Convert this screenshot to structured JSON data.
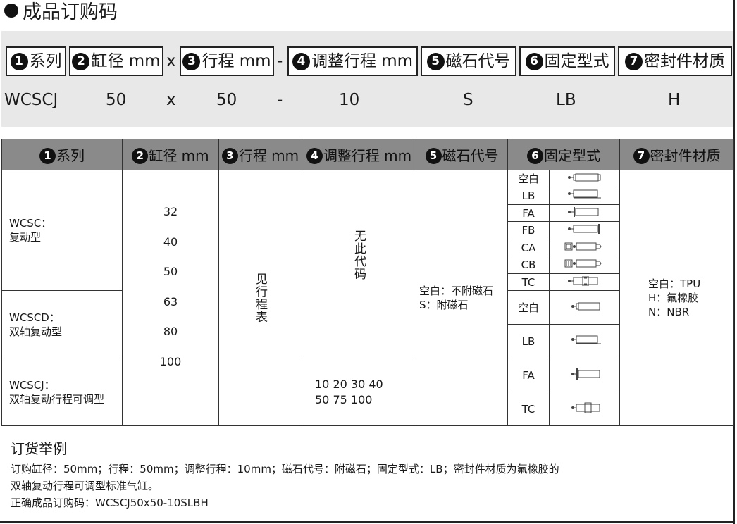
{
  "title": "成品订购码",
  "code_fields": [
    {
      "num": "1",
      "label": "系列"
    },
    {
      "num": "2",
      "label": "缸径 mm"
    },
    {
      "num": "3",
      "label": "行程 mm"
    },
    {
      "num": "4",
      "label": "调整行程 mm"
    },
    {
      "num": "5",
      "label": "磁石代号"
    },
    {
      "num": "6",
      "label": "固定型式"
    },
    {
      "num": "7",
      "label": "密封件材质"
    }
  ],
  "code_separators": [
    "x",
    "-"
  ],
  "code_example": [
    "WCSCJ",
    "50",
    "x",
    "50",
    "-",
    "10",
    "S",
    "LB",
    "H"
  ],
  "table": {
    "headers": [
      {
        "num": "1",
        "label": "系列"
      },
      {
        "num": "2",
        "label": "缸径 mm"
      },
      {
        "num": "3",
        "label": "行程 mm"
      },
      {
        "num": "4",
        "label": "调整行程 mm"
      },
      {
        "num": "5",
        "label": "磁石代号"
      },
      {
        "num": "6",
        "label": "固定型式"
      },
      {
        "num": "7",
        "label": "密封件材质"
      }
    ],
    "series": [
      {
        "code": "WCSC：",
        "desc": "复动型"
      },
      {
        "code": "WCSCD：",
        "desc": "双轴复动型"
      },
      {
        "code": "WCSCJ：",
        "desc": "双轴复动行程可调型"
      }
    ],
    "bores": [
      "32",
      "40",
      "50",
      "63",
      "80",
      "100"
    ],
    "stroke_note": "见行程表",
    "adjust_none": "无此代码",
    "adjust_values_line1": "10 20 30 40",
    "adjust_values_line2": "50 75 100",
    "magnet_line1": "空白：不附磁石",
    "magnet_line2": "S：附磁石",
    "mounts_small": [
      "空白",
      "LB",
      "FA",
      "FB",
      "CA",
      "CB",
      "TC"
    ],
    "mounts_large": [
      "空白",
      "LB",
      "FA",
      "TC"
    ],
    "seal_lines": [
      "空白：TPU",
      "H：氟橡胶",
      "N：NBR"
    ]
  },
  "example": {
    "heading": "订货举例",
    "line1": "订购缸径：50mm；行程：50mm；调整行程：10mm；磁石代号：附磁石；固定型式：LB；密封件材质为氟橡胶的",
    "line2": "双轴复动行程可调型标准气缸。",
    "line3": "正确成品订购码：WCSCJ50x50-10SLBH"
  }
}
